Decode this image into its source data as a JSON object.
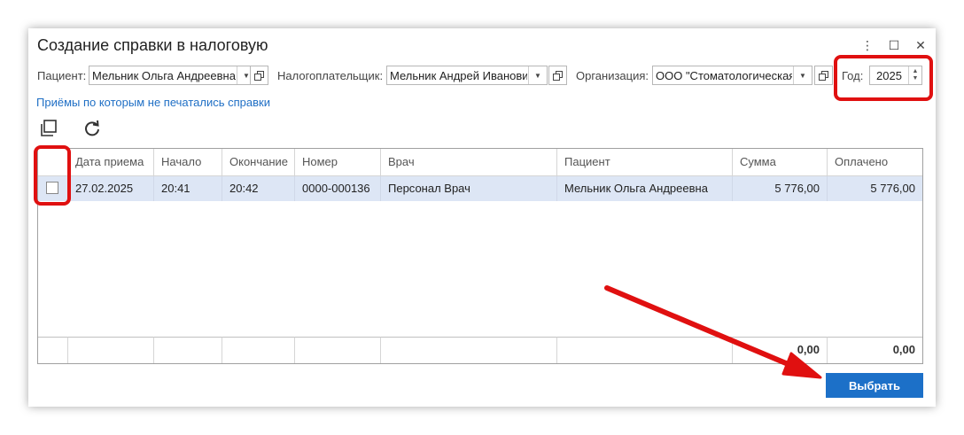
{
  "window": {
    "title": "Создание справки в налоговую",
    "menu_icon": "⋮",
    "maximize_icon": "☐",
    "close_icon": "✕"
  },
  "filters": {
    "patient_label": "Пациент:",
    "patient_value": "Мельник Ольга Андреевна",
    "taxpayer_label": "Налогоплательщик:",
    "taxpayer_value": "Мельник Андрей Иванович",
    "org_label": "Организация:",
    "org_value": "ООО \"Стоматологическая",
    "year_label": "Год:",
    "year_value": "2025"
  },
  "link_text": "Приёмы по которым не печатались справки",
  "table": {
    "columns": [
      "Дата приема",
      "Начало",
      "Окончание",
      "Номер",
      "Врач",
      "Пациент",
      "Сумма",
      "Оплачено"
    ],
    "rows": [
      {
        "date": "27.02.2025",
        "start": "20:41",
        "end": "20:42",
        "number": "0000-000136",
        "doctor": "Персонал Врач",
        "patient": "Мельник Ольга Андреевна",
        "sum": "5 776,00",
        "paid": "5 776,00"
      }
    ],
    "totals": {
      "sum": "0,00",
      "paid": "0,00"
    }
  },
  "buttons": {
    "select": "Выбрать"
  },
  "colors": {
    "accent": "#1c70c8",
    "highlight": "#e01010",
    "row_selected": "#dde6f5"
  }
}
